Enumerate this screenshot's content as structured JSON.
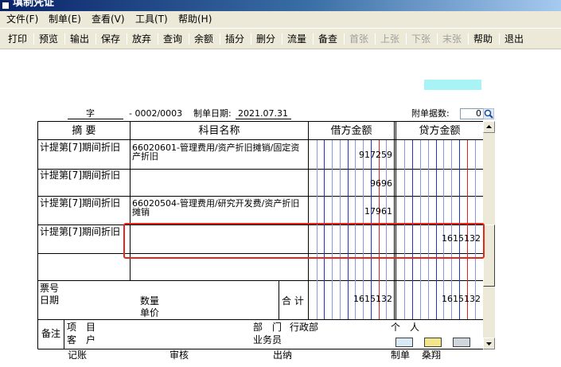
{
  "window": {
    "title": "填制凭证"
  },
  "menu": [
    {
      "label": "文件(F)"
    },
    {
      "label": "制单(E)"
    },
    {
      "label": "查看(V)"
    },
    {
      "label": "工具(T)"
    },
    {
      "label": "帮助(H)"
    }
  ],
  "toolbar": {
    "print": "打印",
    "preview": "预览",
    "export": "输出",
    "save": "保存",
    "discard": "放弃",
    "query": "查询",
    "balance": "余额",
    "insert": "插分",
    "delete": "删分",
    "flow": "流量",
    "note": "备查",
    "first": "首张",
    "prev": "上张",
    "next": "下张",
    "last": "末张",
    "help": "帮助",
    "exit": "退出"
  },
  "voucher": {
    "type_label": "字",
    "number": "- 0002/0003",
    "date_label": "制单日期:",
    "date": "2021.07.31",
    "attach_label": "附单据数:",
    "attach_value": "0",
    "columns": {
      "summary": "摘 要",
      "account": "科目名称",
      "debit": "借方金额",
      "credit": "贷方金额"
    },
    "rows": [
      {
        "summary": "计提第[7]期间折旧",
        "account": "66020601-管理费用/资产折旧摊销/固定资产折旧",
        "debit": "917259",
        "credit": ""
      },
      {
        "summary": "计提第[7]期间折旧",
        "account": "",
        "debit": "9696",
        "credit": ""
      },
      {
        "summary": "计提第[7]期间折旧",
        "account": "66020504-管理费用/研究开发费/资产折旧摊销",
        "debit": "17961",
        "credit": ""
      },
      {
        "summary": "计提第[7]期间折旧",
        "account": "",
        "debit": "",
        "credit": "1615132"
      },
      {
        "summary": "",
        "account": "",
        "debit": "",
        "credit": ""
      }
    ],
    "ticket_label": "票号",
    "date_row_label": "日期",
    "qty_label": "数量",
    "price_label": "单价",
    "total_label": "合 计",
    "total_debit": "1615132",
    "total_credit": "1615132",
    "remark_label": "备注",
    "project_label": "项　目",
    "customer_label": "客　户",
    "dept_label": "部　门",
    "dept_value": "行政部",
    "person_label": "个　人",
    "salesman_label": "业务员"
  },
  "footer": {
    "bookkeeping": "记账",
    "audit": "审核",
    "cashier": "出纳",
    "maker_label": "制单",
    "maker": "桑翔"
  }
}
